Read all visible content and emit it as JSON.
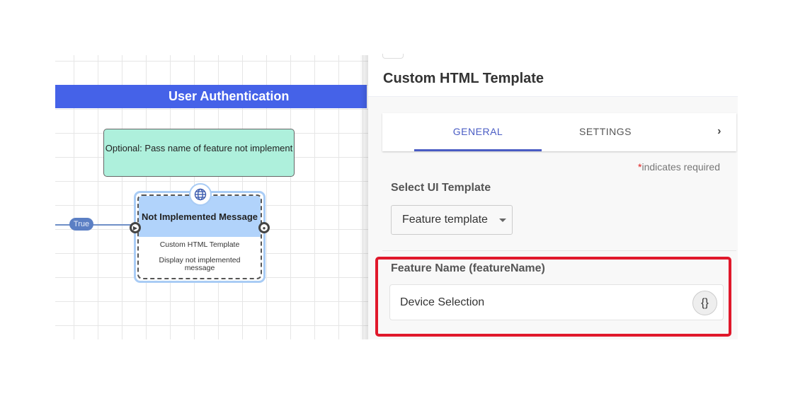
{
  "canvas": {
    "banner_title": "User Authentication",
    "note_text": "Optional: Pass name of feature not implement",
    "edge_label": "True",
    "node": {
      "title": "Not Implemented Message",
      "type": "Custom HTML Template",
      "description": "Display not implemented message",
      "icon": "globe-icon"
    },
    "colors": {
      "banner": "#4562e8",
      "note": "#aef0dc",
      "node_header": "#b1d3fb"
    }
  },
  "panel": {
    "title": "Custom HTML Template",
    "tabs": [
      {
        "label": "GENERAL",
        "active": true
      },
      {
        "label": "SETTINGS",
        "active": false
      }
    ],
    "tabs_next": "›",
    "required_asterisk": "*",
    "required_text": "indicates required",
    "select_label": "Select UI Template",
    "select_value": "Feature template",
    "feature_label": "Feature Name (featureName)",
    "feature_value": "Device Selection",
    "variable_button": "{}",
    "colors": {
      "accent": "#4a5cc4",
      "highlight": "#e0182b"
    }
  }
}
